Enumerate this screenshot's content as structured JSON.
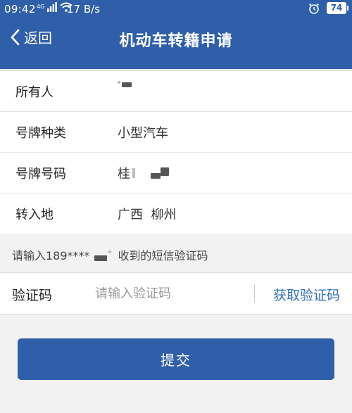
{
  "status_bar": {
    "time": "09:42",
    "network": "4G",
    "speed": "17 B/s",
    "battery": "74"
  },
  "nav": {
    "back_label": "返回",
    "title": "机动车转籍申请"
  },
  "info_rows": [
    {
      "label": "所有人",
      "value": ""
    },
    {
      "label": "号牌种类",
      "value": "小型汽车"
    },
    {
      "label": "号牌号码",
      "value": "桂"
    },
    {
      "label": "转入地",
      "value": "广西  柳州"
    }
  ],
  "sms_hint": {
    "prefix": "请输入189****",
    "suffix": "收到的短信验证码"
  },
  "verify": {
    "label": "验证码",
    "placeholder": "请输入验证码",
    "get_code_label": "获取验证码"
  },
  "submit_label": "提交",
  "colors": {
    "primary": "#2f5fa8",
    "link": "#2f6fb5",
    "background": "#f2f2f2"
  }
}
